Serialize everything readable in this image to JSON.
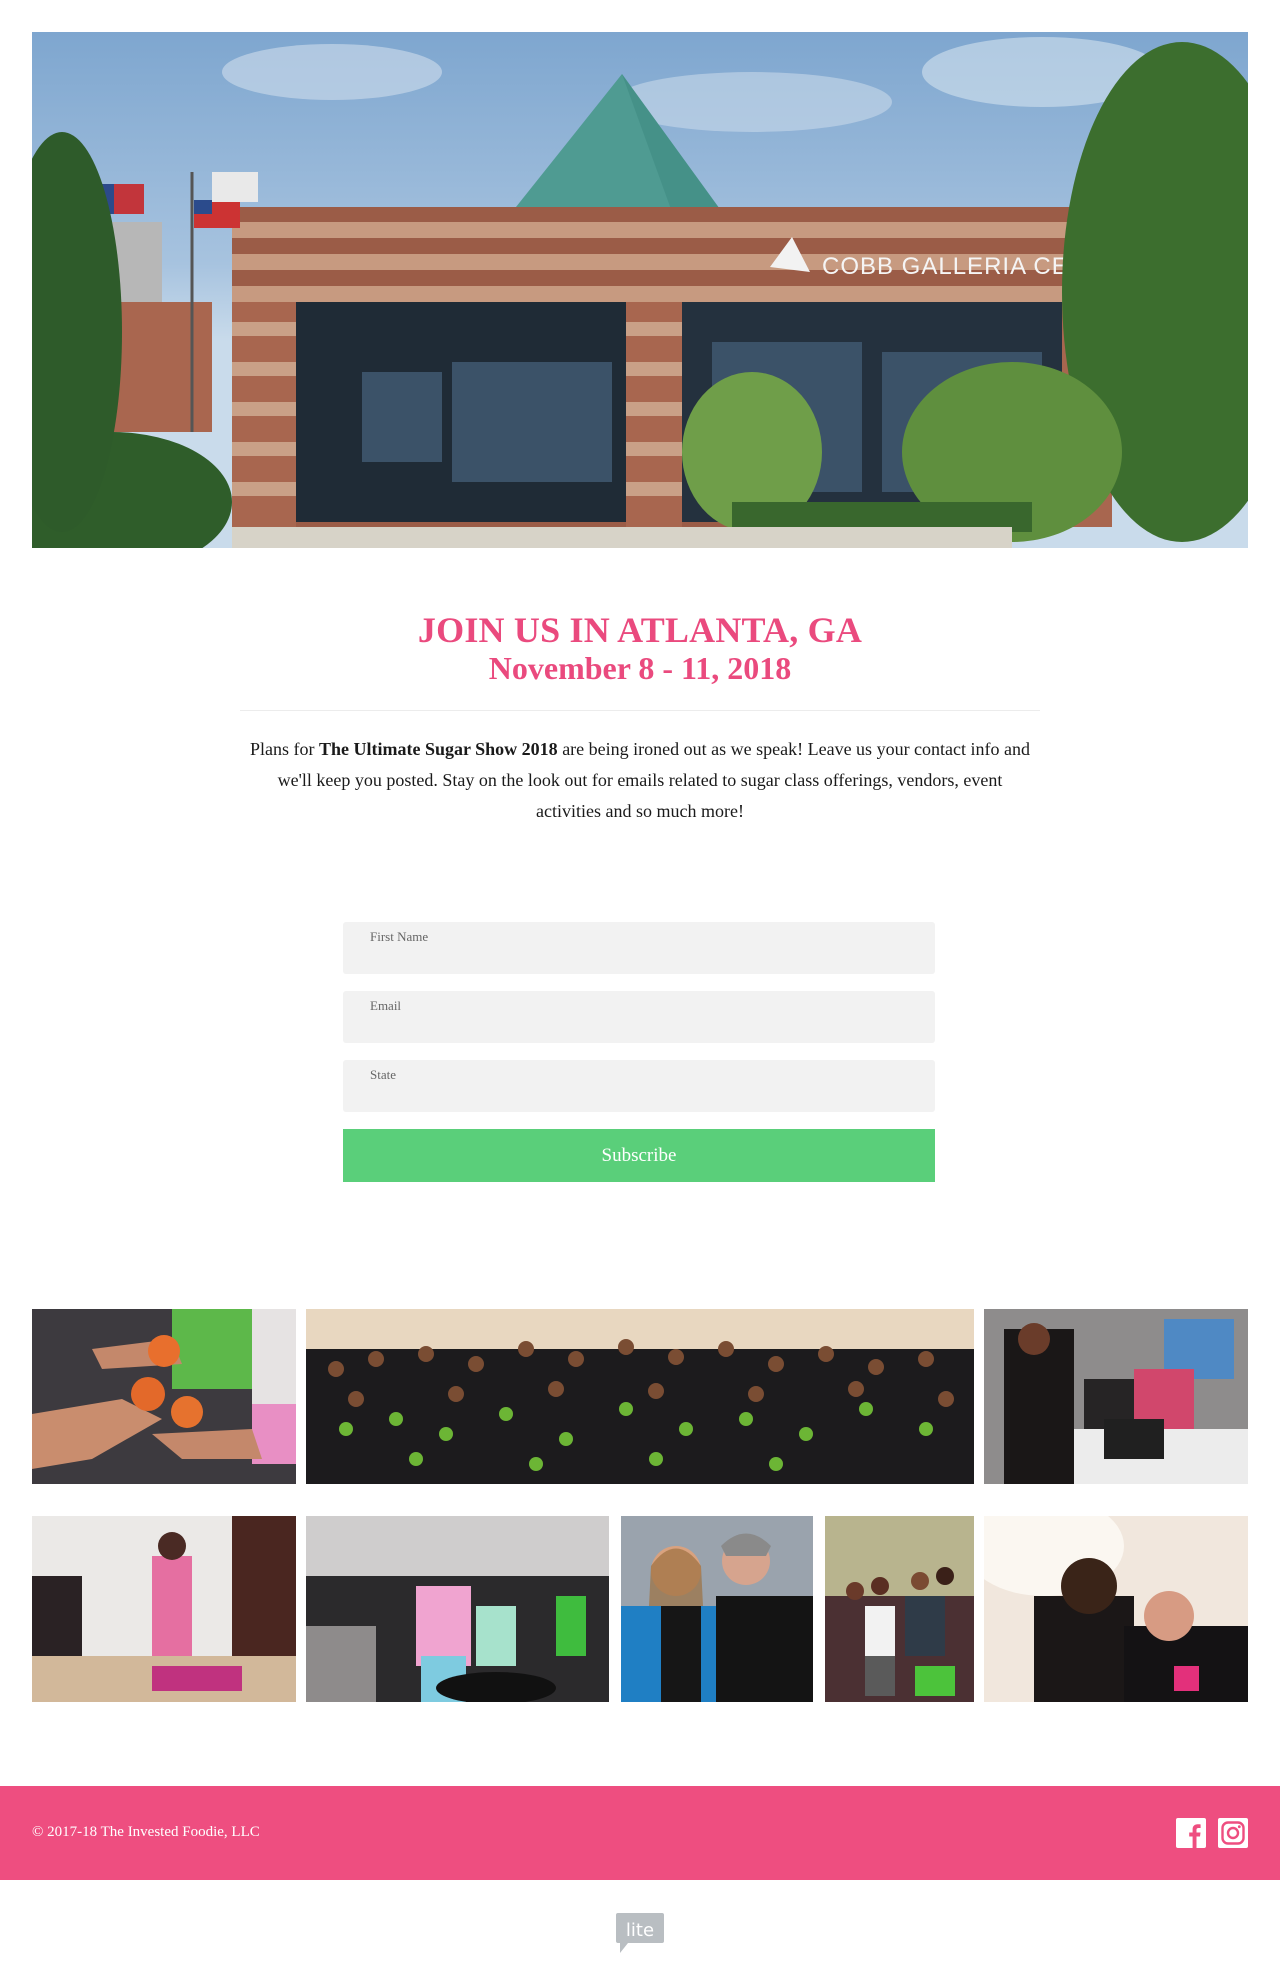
{
  "hero": {
    "image_alt": "Cobb Galleria Centre building exterior",
    "sign_text": "COBB GALLERIA CENTRE"
  },
  "event": {
    "headline": "JOIN US IN ATLANTA, GA",
    "dates": "November 8 - 11, 2018",
    "intro_prefix": "Plans for ",
    "intro_bold": "The Ultimate Sugar Show 2018",
    "intro_suffix": " are being ironed out as we speak! Leave us your contact info and we'll keep you posted. Stay on the look out for emails related to sugar class offerings, vendors, event activities and so much more!"
  },
  "form": {
    "fields": [
      {
        "label": "First Name",
        "value": ""
      },
      {
        "label": "Email",
        "value": ""
      },
      {
        "label": "State",
        "value": ""
      }
    ],
    "submit_label": "Subscribe",
    "submit_color": "#5acf7a"
  },
  "gallery": {
    "rows": [
      [
        {
          "alt": "Hands holding pumpkin sugar cookies"
        },
        {
          "alt": "Large group photo of attendees in black event t-shirts"
        },
        {
          "alt": "Attendees at a vendor booth with laptop"
        }
      ],
      [
        {
          "alt": "Instructor in pink jacket demonstrating at table"
        },
        {
          "alt": "Crowd of attendees in a class room"
        },
        {
          "alt": "Two women posing together"
        },
        {
          "alt": "Small group posing in a kitchen area"
        },
        {
          "alt": "Selfie of two attendees"
        }
      ]
    ]
  },
  "footer": {
    "copyright": "© 2017-18 The Invested Foodie, LLC",
    "social": [
      {
        "name": "facebook",
        "icon": "facebook-icon"
      },
      {
        "name": "instagram",
        "icon": "instagram-icon"
      }
    ],
    "background_color": "#ee4e80"
  },
  "badge": {
    "text": "lite"
  }
}
